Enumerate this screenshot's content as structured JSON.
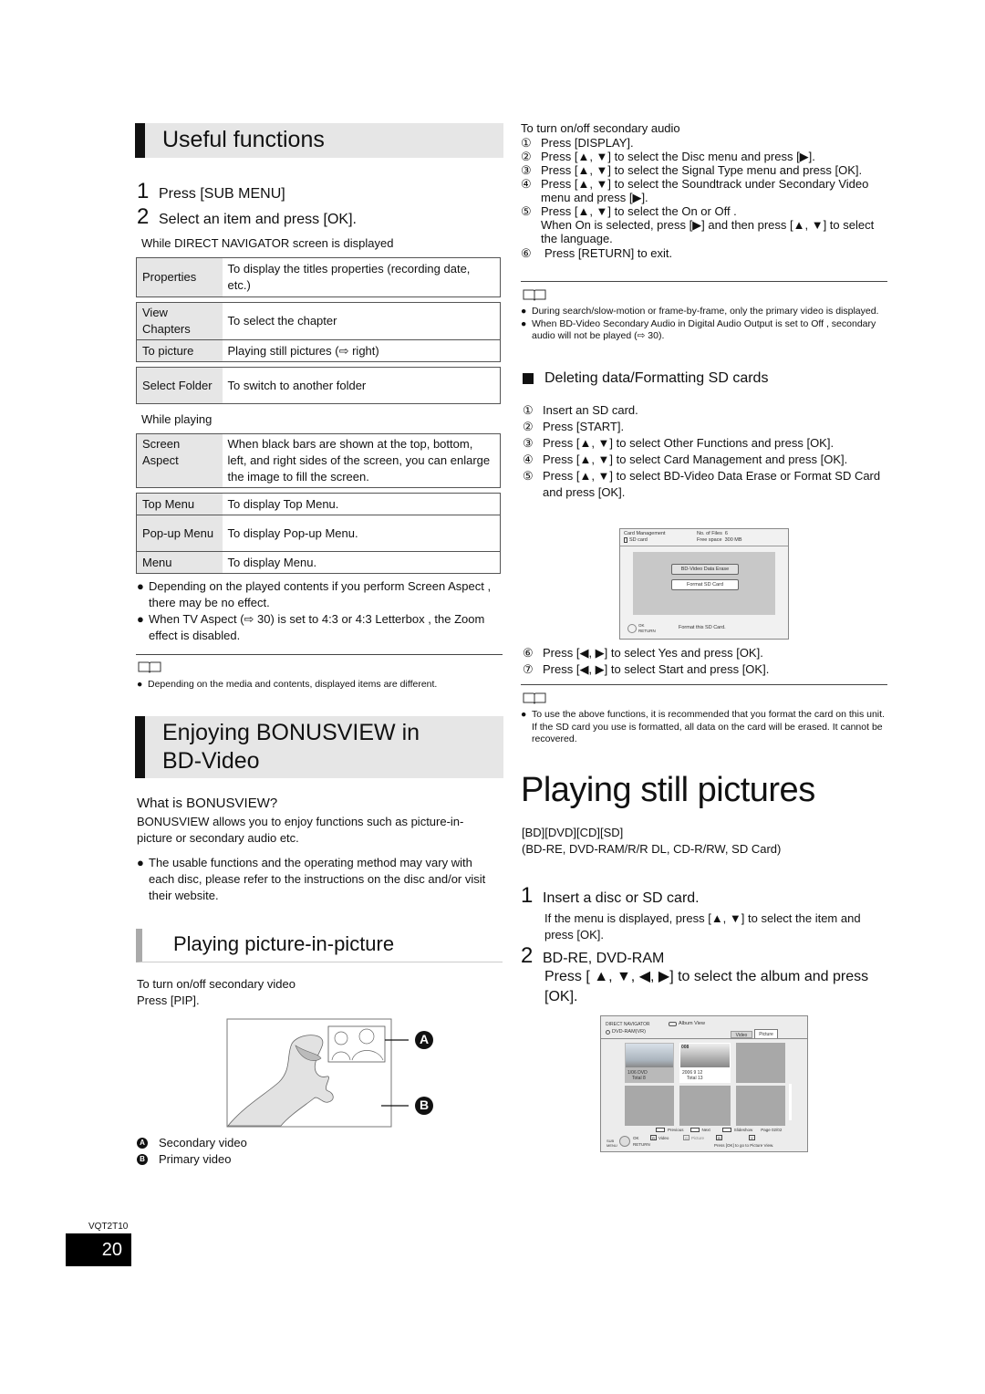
{
  "useful_functions": {
    "title": "Useful functions",
    "steps": [
      {
        "num": "1",
        "text": "Press [SUB MENU]"
      },
      {
        "num": "2",
        "text": "Select an item and press [OK]."
      }
    ],
    "table1_caption": "While DIRECT NAVIGATOR screen is displayed",
    "table1": [
      {
        "key": "Properties",
        "value": "To display the titles properties (recording date, etc.)"
      },
      {
        "key": "View Chapters",
        "value": "To select the chapter"
      },
      {
        "key": "To picture",
        "value": "Playing still pictures (⇨ right)"
      },
      {
        "key": "Select Folder",
        "value": "To switch to another folder"
      }
    ],
    "table2_caption": "While playing",
    "table2": [
      {
        "key": "Screen Aspect",
        "value": "When black bars are shown at the top, bottom, left, and right sides of the screen, you can enlarge the image to fill the screen."
      },
      {
        "key": "Top Menu",
        "value": "To display Top Menu."
      },
      {
        "key": "Pop-up Menu",
        "value": "To display Pop-up Menu."
      },
      {
        "key": "Menu",
        "value": "To display Menu."
      }
    ],
    "bullets": [
      "Depending on the played contents if you perform  Screen Aspect , there may be no effect.",
      "When  TV Aspect  (⇨ 30) is set to  4:3  or  4:3 Letterbox , the  Zoom  effect is disabled."
    ],
    "note": "Depending on the media and contents, displayed items are different."
  },
  "bonusview": {
    "title_line1": "Enjoying BONUSVIEW in",
    "title_line2": "BD-Video",
    "what_heading": "What is BONUSVIEW?",
    "what_text": "BONUSVIEW allows you to enjoy functions such as picture-in-picture or secondary audio etc.",
    "bullet": "The usable functions and the operating method may vary with each disc, please refer to the instructions on the disc and/or visit their website.",
    "pip_title": "Playing picture-in-picture",
    "pip_line1": "To turn on/off secondary video",
    "pip_line2": "Press [PIP].",
    "label_a": "A",
    "label_b": "B",
    "legend": [
      {
        "mark": "A",
        "text": "Secondary video"
      },
      {
        "mark": "B",
        "text": "Primary video"
      }
    ]
  },
  "secondary_audio": {
    "heading": "To turn on/off secondary audio",
    "steps": [
      {
        "num": "①",
        "text": "Press [DISPLAY]."
      },
      {
        "num": "②",
        "text": "Press [▲, ▼] to select the  Disc  menu and press [▶]."
      },
      {
        "num": "③",
        "text": "Press [▲, ▼] to select the  Signal Type  menu and press [OK]."
      },
      {
        "num": "④",
        "text": "Press [▲, ▼] to select the  Soundtrack  under  Secondary Video  menu and press [▶]."
      },
      {
        "num": "⑤",
        "text": "Press [▲, ▼] to select the  On  or  Off .\nWhen  On  is selected, press [▶] and then press [▲, ▼] to select the language."
      },
      {
        "num": "⑥",
        "text": "Press [RETURN] to exit."
      }
    ],
    "notes": [
      "During search/slow-motion or frame-by-frame, only the primary video is displayed.",
      "When  BD-Video Secondary Audio  in  Digital Audio Output  is set to  Off , secondary audio will not be played (⇨ 30)."
    ]
  },
  "sd_cards": {
    "heading": "Deleting data/Formatting SD cards",
    "steps": [
      {
        "num": "①",
        "text": "Insert an SD card."
      },
      {
        "num": "②",
        "text": "Press [START]."
      },
      {
        "num": "③",
        "text": "Press [▲, ▼] to select  Other Functions  and press [OK]."
      },
      {
        "num": "④",
        "text": "Press [▲, ▼] to select  Card Management  and press [OK]."
      },
      {
        "num": "⑤",
        "text": "Press [▲, ▼] to select  BD-Video Data Erase  or  Format SD Card  and press [OK]."
      }
    ],
    "steps_after": [
      {
        "num": "⑥",
        "text": "Press [◀, ▶] to select  Yes  and press [OK]."
      },
      {
        "num": "⑦",
        "text": "Press [◀, ▶] to select  Start  and press [OK]."
      }
    ],
    "screen": {
      "title": "Card Management",
      "device": "SD card",
      "files_label": "No. of Files",
      "files_value": "6",
      "space_label": "Free space",
      "space_value": "300 MB",
      "btn1": "BD-Video Data Erase",
      "btn2": "Format SD Card",
      "ok": "OK",
      "return": "RETURN",
      "message": "Format this SD Card."
    },
    "note": "To use the above functions, it is recommended that you format the card on this unit. If the SD card you use is formatted, all data on the card will be erased. It cannot be recovered."
  },
  "still_pictures": {
    "title": "Playing still pictures",
    "media_tags": "[BD][DVD][CD][SD]",
    "media_desc": "(BD-RE, DVD-RAM/R/R DL, CD-R/RW, SD Card)",
    "step1_num": "1",
    "step1": "Insert a disc or SD card.",
    "step1_sub": "If the menu is displayed, press [▲, ▼] to select the item and press [OK].",
    "step2_num": "2",
    "step2_head": "BD-RE, DVD-RAM",
    "step2_text": "Press [ ▲, ▼, ◀, ▶] to select the album and press [OK].",
    "navigator": {
      "title": "DIRECT NAVIGATOR",
      "view": "Album View",
      "device": "DVD-RAM(VR)",
      "tab_video": "Video",
      "tab_picture": "Picture",
      "album1_date": "1/06  DVD",
      "album1_total": "Total 8",
      "album2_num": "008",
      "album2_date": "2006  9  12",
      "album2_total": "Total 13",
      "previous": "Previous",
      "next": "Next",
      "slideshow": "Slideshow",
      "page": "Page  02/02",
      "sub_menu": "SUB MENU",
      "ok": "OK",
      "return": "RETURN",
      "key_r": "R",
      "key_r_label": "Video",
      "key_g": "G",
      "key_g_label": "Picture",
      "key_b": "B",
      "key_y": "Y",
      "hint": "Press [OK] to go to Picture View."
    }
  },
  "footer": {
    "code": "VQT2T10",
    "page": "20"
  }
}
